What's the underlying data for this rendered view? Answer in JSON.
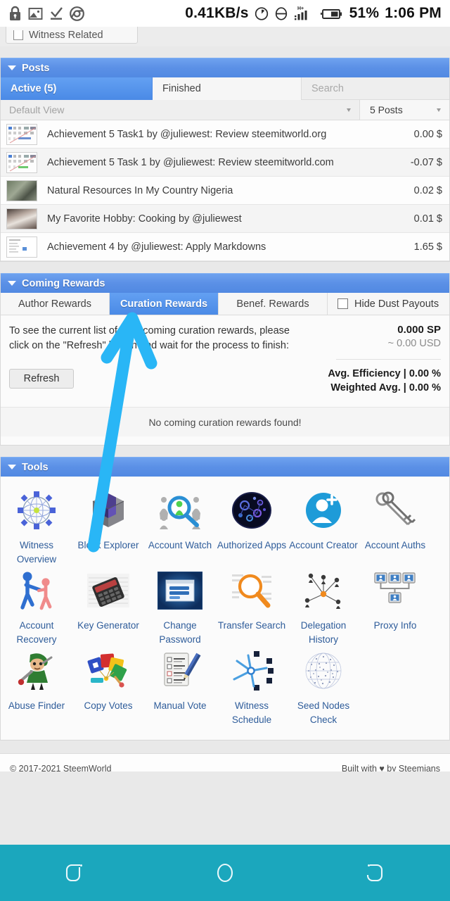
{
  "statusbar": {
    "icons_left": [
      "lock-icon",
      "screenshot-icon",
      "download-complete-icon",
      "chrome-icon"
    ],
    "network_speed": "0.41KB/s",
    "icons_right": [
      "alarm-icon",
      "do-not-disturb-icon",
      "signal-bars-icon",
      "battery-icon"
    ],
    "network_type": "H+",
    "battery_percent": "51%",
    "clock": "1:06 PM"
  },
  "top_partial": {
    "checkbox_label": "Witness Related"
  },
  "posts": {
    "header_title": "Posts",
    "caret": "caret-down-icon",
    "tabs": [
      {
        "label": "Active (5)",
        "active": true
      },
      {
        "label": "Finished",
        "active": false
      }
    ],
    "search_placeholder": "Search",
    "view_select": "Default View",
    "count_select": "5 Posts",
    "columns": [
      "thumbnail",
      "title",
      "value"
    ],
    "rows": [
      {
        "title": "Achievement 5 Task1 by @juliewest: Review steemitworld.org",
        "value": "0.00 $",
        "thumb": "chart"
      },
      {
        "title": "Achievement 5 Task 1 by @juliewest: Review steemitworld.com",
        "value": "-0.07 $",
        "thumb": "chart"
      },
      {
        "title": "Natural Resources In My Country Nigeria",
        "value": "0.02 $",
        "thumb": "photo1"
      },
      {
        "title": "My Favorite Hobby: Cooking by @juliewest",
        "value": "0.01 $",
        "thumb": "photo2"
      },
      {
        "title": "Achievement 4 by @juliewest: Apply Markdowns",
        "value": "1.65 $",
        "thumb": "doc"
      }
    ]
  },
  "coming_rewards": {
    "header_title": "Coming Rewards",
    "caret": "caret-down-icon",
    "tabs": [
      {
        "label": "Author Rewards",
        "active": false
      },
      {
        "label": "Curation Rewards",
        "active": true
      },
      {
        "label": "Benef. Rewards",
        "active": false
      }
    ],
    "hide_dust_label": "Hide Dust Payouts",
    "hide_dust_checked": false,
    "instructions": "To see the current list of your coming curation rewards, please click on the \"Refresh\" button and wait for the process to finish:",
    "refresh_label": "Refresh",
    "amount_sp": "0.000 SP",
    "amount_usd": "~ 0.00 USD",
    "avg_efficiency": "Avg. Efficiency | 0.00 %",
    "weighted_avg": "Weighted Avg. | 0.00 %",
    "empty_message": "No coming curation rewards found!"
  },
  "tools": {
    "header_title": "Tools",
    "caret": "caret-down-icon",
    "items": [
      {
        "label": "Witness Overview",
        "icon": "witness-overview-icon"
      },
      {
        "label": "Block Explorer",
        "icon": "block-explorer-icon"
      },
      {
        "label": "Account Watch",
        "icon": "account-watch-icon"
      },
      {
        "label": "Authorized Apps",
        "icon": "authorized-apps-icon"
      },
      {
        "label": "Account Creator",
        "icon": "account-creator-icon"
      },
      {
        "label": "Account Auths",
        "icon": "account-auths-icon"
      },
      {
        "label": "Account Recovery",
        "icon": "account-recovery-icon"
      },
      {
        "label": "Key Generator",
        "icon": "key-generator-icon"
      },
      {
        "label": "Change Password",
        "icon": "change-password-icon"
      },
      {
        "label": "Transfer Search",
        "icon": "transfer-search-icon"
      },
      {
        "label": "Delegation History",
        "icon": "delegation-history-icon"
      },
      {
        "label": "Proxy Info",
        "icon": "proxy-info-icon"
      },
      {
        "label": "Abuse Finder",
        "icon": "abuse-finder-icon"
      },
      {
        "label": "Copy Votes",
        "icon": "copy-votes-icon"
      },
      {
        "label": "Manual Vote",
        "icon": "manual-vote-icon"
      },
      {
        "label": "Witness Schedule",
        "icon": "witness-schedule-icon"
      },
      {
        "label": "Seed Nodes Check",
        "icon": "seed-nodes-check-icon"
      }
    ]
  },
  "footer": {
    "left": "© 2017-2021 SteemWorld",
    "right": "Built with ♥ by Steemians"
  },
  "navbar": {
    "buttons": [
      "recents-icon",
      "home-icon",
      "back-icon"
    ]
  },
  "annotation": {
    "type": "arrow",
    "color": "#29b6f6",
    "points_to": "Curation Rewards"
  },
  "colors": {
    "header_blue": "#5b90e6",
    "tab_active_blue": "#4a8ae6",
    "navbar_teal": "#1ba7bd",
    "link_blue": "#2e5c9a",
    "arrow_blue": "#29b6f6"
  }
}
